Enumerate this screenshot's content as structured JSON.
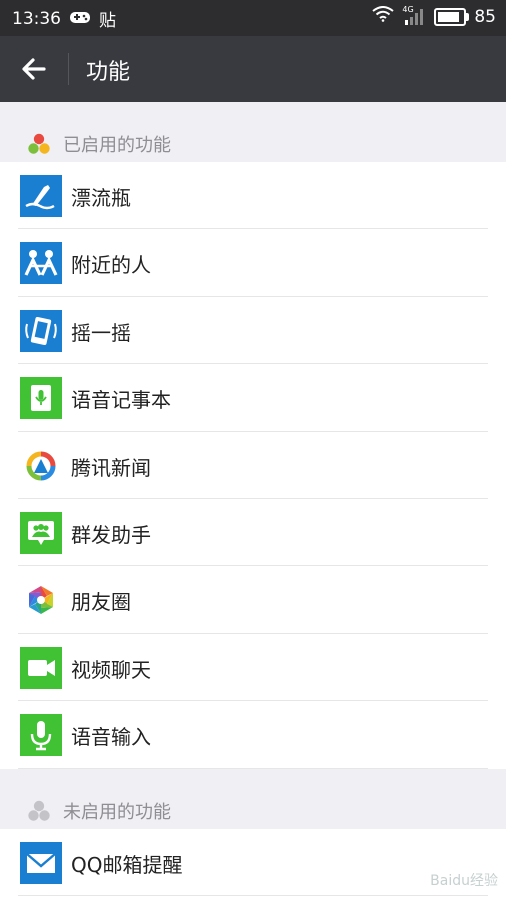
{
  "status": {
    "time": "13:36",
    "app_badge": "贴",
    "network": "4G",
    "battery": "85",
    "battery_level": 0.85
  },
  "header": {
    "title": "功能",
    "back_icon": "arrow-left-icon"
  },
  "enabled": {
    "label": "已启用的功能",
    "items": [
      {
        "label": "漂流瓶",
        "icon": "drift-bottle-icon",
        "color": "#1a7fd1"
      },
      {
        "label": "附近的人",
        "icon": "people-nearby-icon",
        "color": "#1a7fd1"
      },
      {
        "label": "摇一摇",
        "icon": "shake-icon",
        "color": "#1a7fd1"
      },
      {
        "label": "语音记事本",
        "icon": "voice-notepad-icon",
        "color": "#41c234"
      },
      {
        "label": "腾讯新闻",
        "icon": "tencent-news-icon",
        "color": "#ffffff"
      },
      {
        "label": "群发助手",
        "icon": "broadcast-assistant-icon",
        "color": "#41c234"
      },
      {
        "label": "朋友圈",
        "icon": "moments-icon",
        "color": "#ffffff"
      },
      {
        "label": "视频聊天",
        "icon": "video-chat-icon",
        "color": "#41c234"
      },
      {
        "label": "语音输入",
        "icon": "voice-input-icon",
        "color": "#41c234"
      }
    ]
  },
  "disabled": {
    "label": "未启用的功能",
    "items": [
      {
        "label": "QQ邮箱提醒",
        "icon": "mail-icon",
        "color": "#1a7fd1"
      }
    ]
  },
  "watermark": "Baidu经验"
}
